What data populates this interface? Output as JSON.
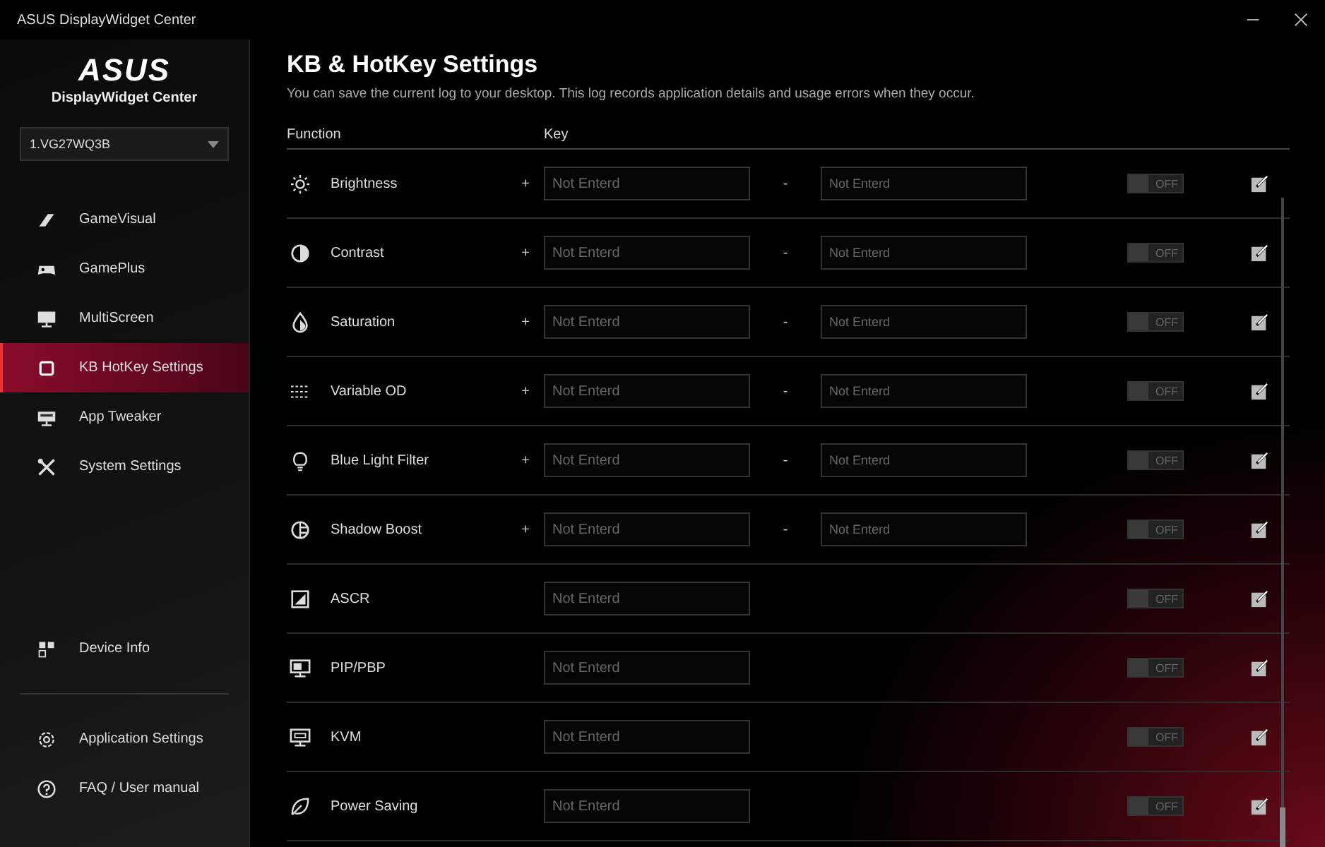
{
  "window": {
    "title": "ASUS DisplayWidget Center"
  },
  "sidebar": {
    "logo": "ASUS",
    "app_name": "DisplayWidget Center",
    "monitor_select": {
      "value": "1.VG27WQ3B"
    },
    "items": [
      {
        "label": "GameVisual",
        "selected": false
      },
      {
        "label": "GamePlus",
        "selected": false
      },
      {
        "label": "MultiScreen",
        "selected": false
      },
      {
        "label": "KB HotKey Settings",
        "selected": true
      },
      {
        "label": "App Tweaker",
        "selected": false
      },
      {
        "label": "System Settings",
        "selected": false
      }
    ],
    "device_item": {
      "label": "Device Info"
    },
    "bottom_items": [
      {
        "label": "Application Settings"
      },
      {
        "label": "FAQ / User manual"
      }
    ]
  },
  "page": {
    "title": "KB & HotKey Settings",
    "description": "You can save the current log to your desktop. This log records application details and usage errors when they occur."
  },
  "table": {
    "columns": [
      "Function",
      "Key"
    ],
    "rows": [
      {
        "kind": "pair",
        "function": "Brightness",
        "plus": "+",
        "minus": "-",
        "key_placeholder": "Not Enterd",
        "key2_placeholder": "Not Enterd",
        "toggle": {
          "label": "OFF",
          "on": false
        }
      },
      {
        "kind": "pair",
        "function": "Contrast",
        "plus": "+",
        "minus": "-",
        "key_placeholder": "Not Enterd",
        "key2_placeholder": "Not Enterd",
        "toggle": {
          "label": "OFF",
          "on": false
        }
      },
      {
        "kind": "pair",
        "function": "Saturation",
        "plus": "+",
        "minus": "-",
        "key_placeholder": "Not Enterd",
        "key2_placeholder": "Not Enterd",
        "toggle": {
          "label": "OFF",
          "on": false
        }
      },
      {
        "kind": "pair",
        "function": "Variable OD",
        "plus": "+",
        "minus": "-",
        "key_placeholder": "Not Enterd",
        "key2_placeholder": "Not Enterd",
        "toggle": {
          "label": "OFF",
          "on": false
        }
      },
      {
        "kind": "pair",
        "function": "Blue Light Filter",
        "plus": "+",
        "minus": "-",
        "key_placeholder": "Not Enterd",
        "key2_placeholder": "Not Enterd",
        "toggle": {
          "label": "OFF",
          "on": false
        }
      },
      {
        "kind": "pair",
        "function": "Shadow Boost",
        "plus": "+",
        "minus": "-",
        "key_placeholder": "Not Enterd",
        "key2_placeholder": "Not Enterd",
        "toggle": {
          "label": "OFF",
          "on": false
        }
      },
      {
        "kind": "single",
        "function": "ASCR",
        "key_placeholder": "Not Enterd",
        "toggle": {
          "label": "OFF",
          "on": false
        }
      },
      {
        "kind": "single",
        "function": "PIP/PBP",
        "key_placeholder": "Not Enterd",
        "toggle": {
          "label": "OFF",
          "on": false
        }
      },
      {
        "kind": "single",
        "function": "KVM",
        "key_placeholder": "Not Enterd",
        "toggle": {
          "label": "OFF",
          "on": false
        }
      },
      {
        "kind": "single",
        "function": "Power Saving",
        "key_placeholder": "Not Enterd",
        "toggle": {
          "label": "OFF",
          "on": false
        }
      }
    ]
  }
}
